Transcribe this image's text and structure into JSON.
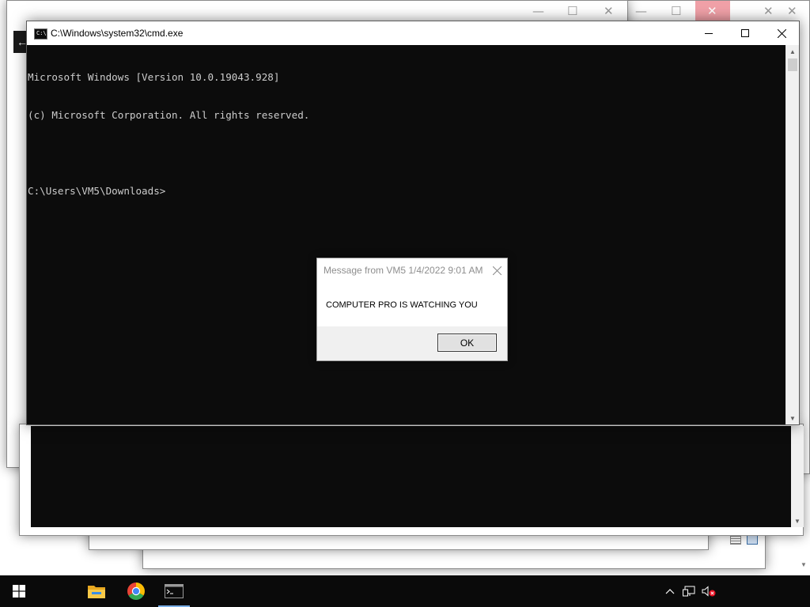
{
  "cmd": {
    "title": "C:\\Windows\\system32\\cmd.exe",
    "icon_text": "C:\\",
    "console_lines": [
      "Microsoft Windows [Version 10.0.19043.928]",
      "(c) Microsoft Corporation. All rights reserved.",
      "",
      "C:\\Users\\VM5\\Downloads>"
    ]
  },
  "message_box": {
    "title": "Message from VM5 1/4/2022 9:01 AM",
    "text": "COMPUTER PRO IS WATCHING YOU",
    "ok_label": "OK"
  },
  "background_windows": {
    "controls": [
      "minimize-icon",
      "maximize-icon",
      "close-icon"
    ],
    "close_hover_color": "#f1a1a8"
  },
  "taskbar": {
    "pinned": [
      "start-windows-icon",
      "file-explorer-icon",
      "chrome-icon",
      "command-prompt-icon"
    ],
    "tray": [
      "chevron-up-icon",
      "network-icon",
      "volume-muted-icon"
    ]
  },
  "colors": {
    "console_background": "#0c0c0c",
    "console_text": "#cccccc",
    "taskbar": "#0a0a0a"
  }
}
